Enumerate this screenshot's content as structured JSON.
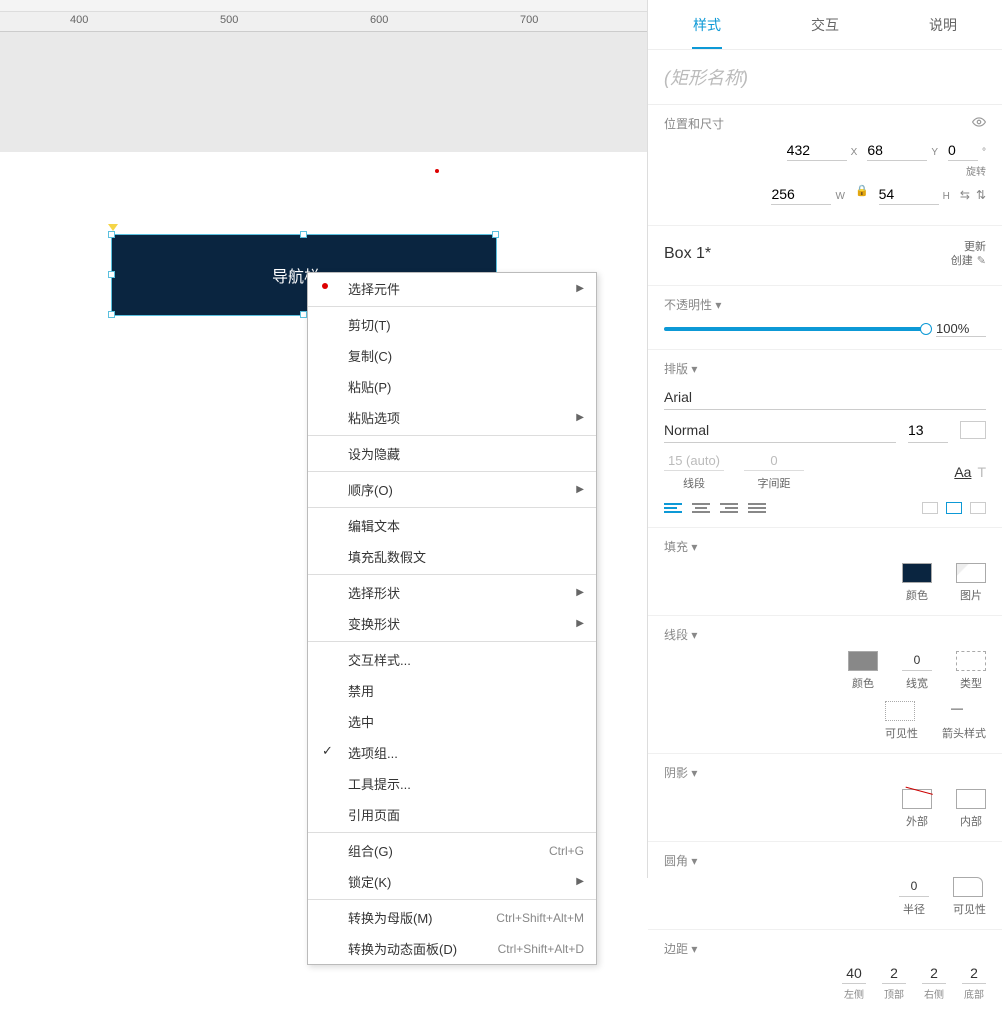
{
  "ruler": {
    "ticks": [
      "400",
      "500",
      "600",
      "700"
    ]
  },
  "shape": {
    "label": "导航栏一"
  },
  "context_menu": {
    "items": [
      {
        "label": "选择元件",
        "arrow": true,
        "red_dot": true
      },
      {
        "sep": true
      },
      {
        "label": "剪切(T)"
      },
      {
        "label": "复制(C)"
      },
      {
        "label": "粘贴(P)"
      },
      {
        "label": "粘贴选项",
        "arrow": true
      },
      {
        "sep": true
      },
      {
        "label": "设为隐藏"
      },
      {
        "sep": true
      },
      {
        "label": "顺序(O)",
        "arrow": true
      },
      {
        "sep": true
      },
      {
        "label": "编辑文本"
      },
      {
        "label": "填充乱数假文"
      },
      {
        "sep": true
      },
      {
        "label": "选择形状",
        "arrow": true
      },
      {
        "label": "变换形状",
        "arrow": true
      },
      {
        "sep": true
      },
      {
        "label": "交互样式..."
      },
      {
        "label": "禁用"
      },
      {
        "label": "选中"
      },
      {
        "label": "选项组...",
        "checked": true
      },
      {
        "label": "工具提示..."
      },
      {
        "label": "引用页面"
      },
      {
        "sep": true
      },
      {
        "label": "组合(G)",
        "shortcut": "Ctrl+G"
      },
      {
        "label": "锁定(K)",
        "arrow": true
      },
      {
        "sep": true
      },
      {
        "label": "转换为母版(M)",
        "shortcut": "Ctrl+Shift+Alt+M"
      },
      {
        "label": "转换为动态面板(D)",
        "shortcut": "Ctrl+Shift+Alt+D"
      }
    ]
  },
  "panel": {
    "tabs": {
      "style": "样式",
      "interact": "交互",
      "note": "说明"
    },
    "name_placeholder": "(矩形名称)",
    "pos_size": {
      "header": "位置和尺寸",
      "x": "432",
      "xl": "X",
      "y": "68",
      "yl": "Y",
      "r": "0",
      "rl": "°",
      "rlabel": "旋转",
      "w": "256",
      "wl": "W",
      "h": "54",
      "hl": "H"
    },
    "style": {
      "name": "Box 1*",
      "update": "更新",
      "create": "创建"
    },
    "opacity": {
      "header": "不透明性 ▾",
      "value": "100%"
    },
    "typo": {
      "header": "排版 ▾",
      "font": "Arial",
      "weight": "Normal",
      "size": "13",
      "line_height": "15 (auto)",
      "line_height_label": "线段",
      "letter_spacing": "0",
      "letter_spacing_label": "字间距"
    },
    "fill": {
      "header": "填充 ▾",
      "color_label": "颜色",
      "image_label": "图片",
      "color": "#0a2540"
    },
    "stroke": {
      "header": "线段 ▾",
      "color_label": "颜色",
      "width": "0",
      "width_label": "线宽",
      "type_label": "类型",
      "vis_label": "可见性",
      "arrow_label": "箭头样式"
    },
    "shadow": {
      "header": "阴影 ▾",
      "outer": "外部",
      "inner": "内部"
    },
    "corner": {
      "header": "圆角 ▾",
      "radius": "0",
      "radius_label": "半径",
      "vis_label": "可见性"
    },
    "padding": {
      "header": "边距 ▾",
      "left": "40",
      "left_label": "左侧",
      "top": "2",
      "top_label": "顶部",
      "right": "2",
      "right_label": "右侧",
      "bottom": "2",
      "bottom_label": "底部"
    }
  }
}
